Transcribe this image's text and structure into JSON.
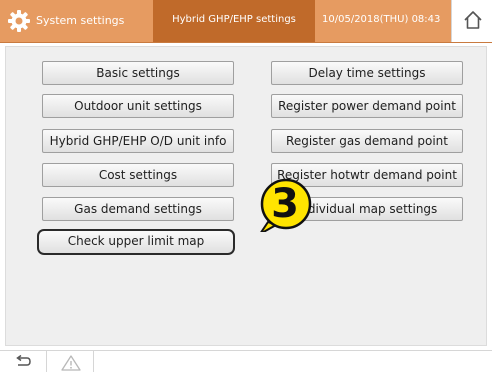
{
  "header": {
    "title": "System settings",
    "section": "Hybrid GHP/EHP settings",
    "datetime": "10/05/2018(THU) 08:43",
    "accent_color": "#e69b61",
    "section_color": "#c06a2a"
  },
  "icons": {
    "settings": "gear-icon",
    "home": "home-icon",
    "back": "back-arrow-icon",
    "alert": "warning-icon"
  },
  "buttons": {
    "left": [
      "Basic settings",
      "Outdoor unit settings",
      "Hybrid GHP/EHP O/D unit info",
      "Cost settings",
      "Gas demand settings",
      "Check upper limit map"
    ],
    "right": [
      "Delay time settings",
      "Register power demand point",
      "Register gas demand point",
      "Register hotwtr demand point",
      "Individual map settings"
    ]
  },
  "callout": {
    "number": "3"
  }
}
